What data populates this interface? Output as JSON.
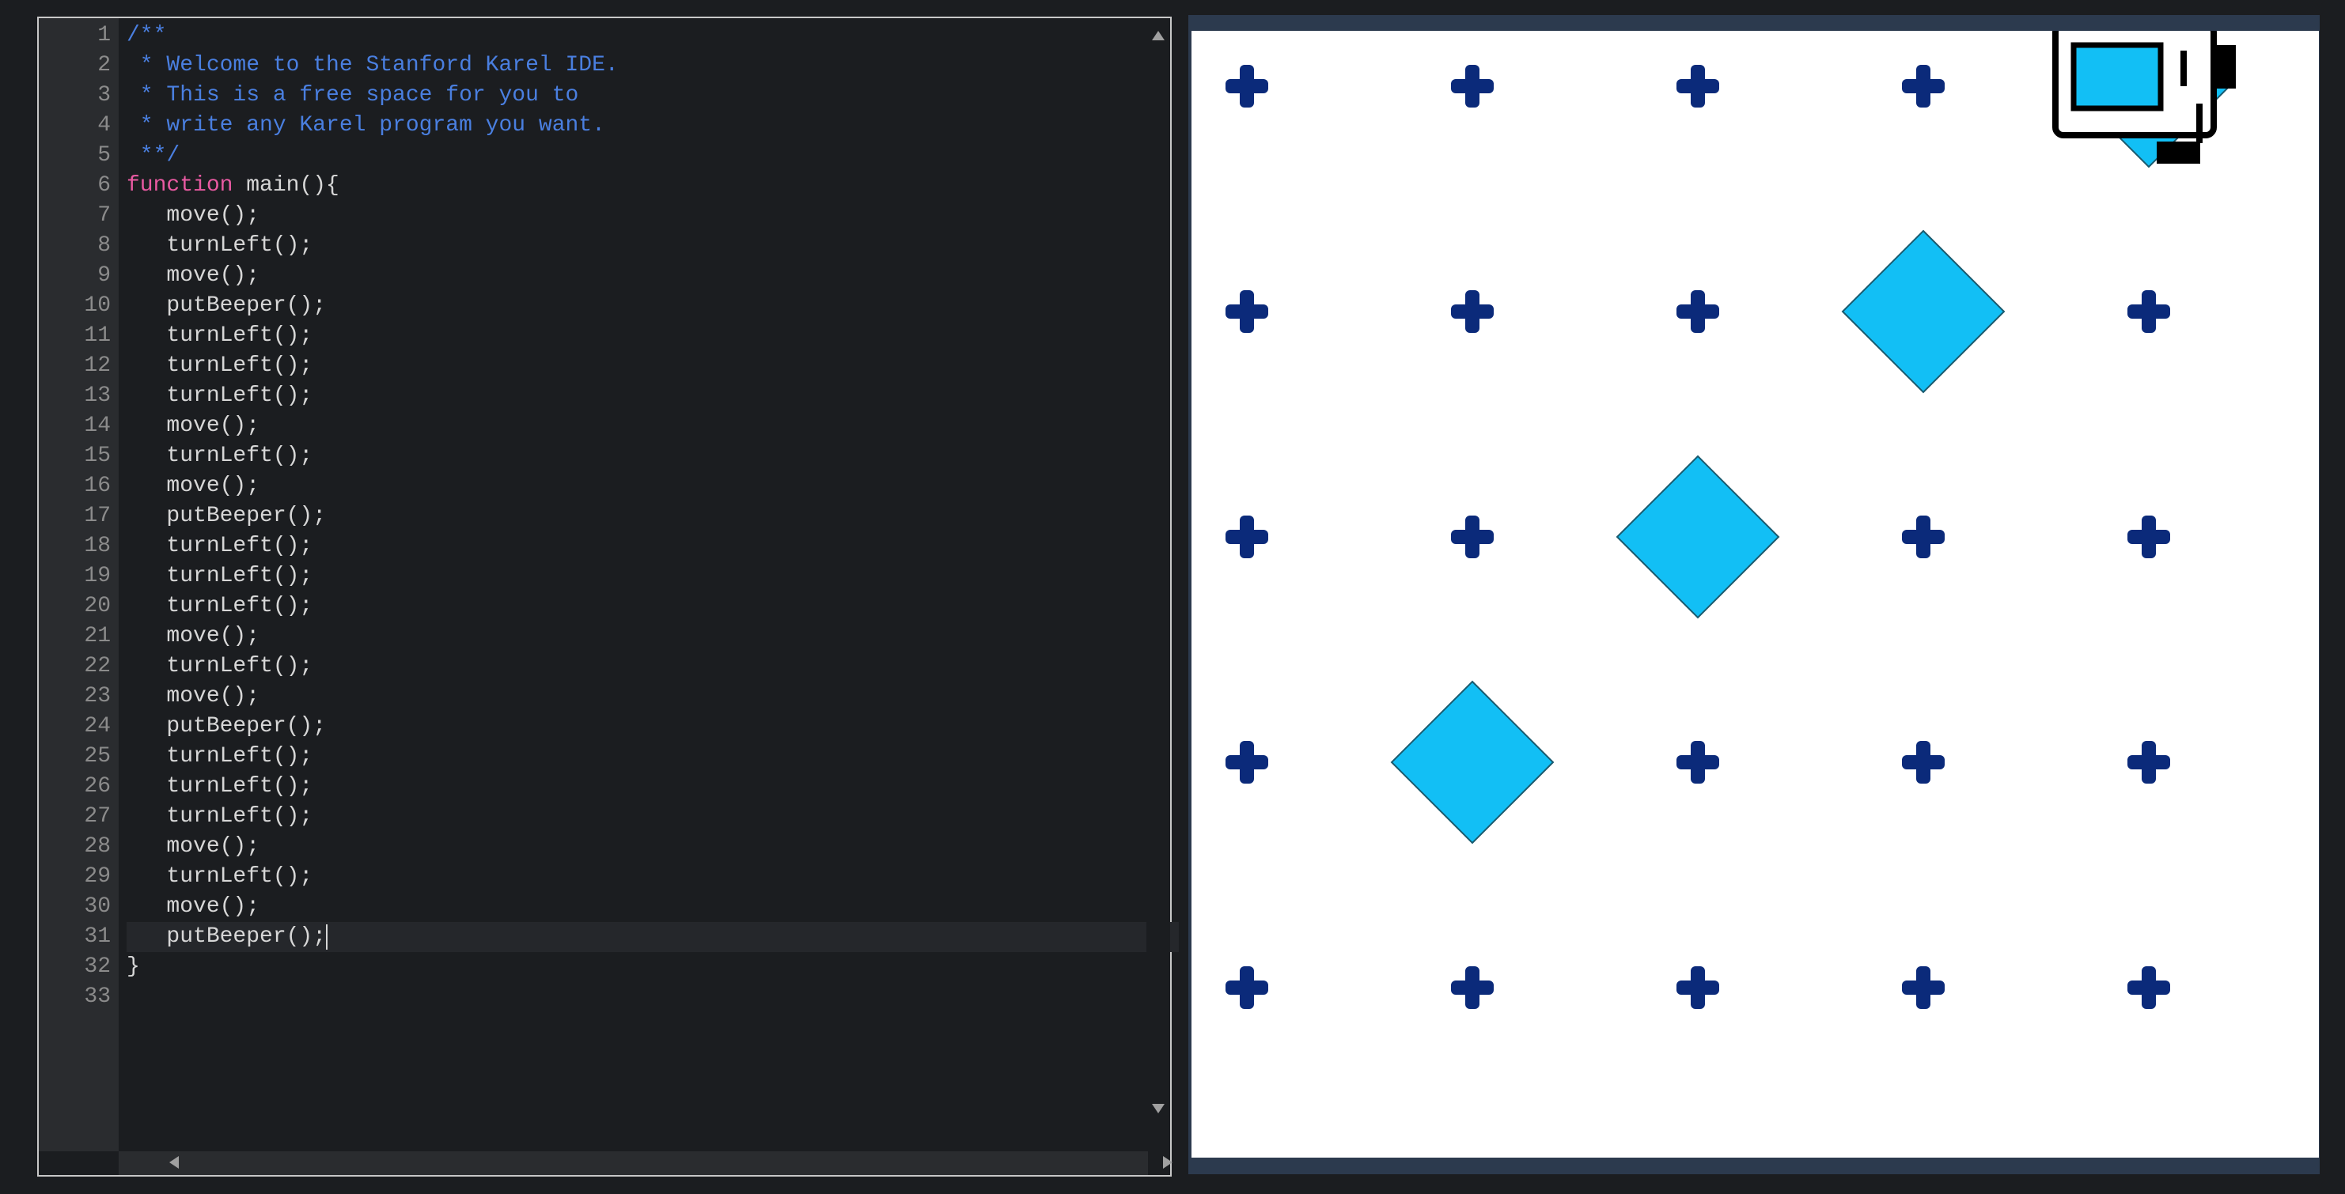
{
  "editor": {
    "lines": [
      {
        "num": "1",
        "text": "/**",
        "style": "comment"
      },
      {
        "num": "2",
        "text": " * Welcome to the Stanford Karel IDE.",
        "style": "comment"
      },
      {
        "num": "3",
        "text": " * This is a free space for you to",
        "style": "comment"
      },
      {
        "num": "4",
        "text": " * write any Karel program you want.",
        "style": "comment"
      },
      {
        "num": "5",
        "text": " **/",
        "style": "comment"
      },
      {
        "num": "6",
        "keyword": "function",
        "text": " main(){",
        "style": "code"
      },
      {
        "num": "7",
        "text": "   move();",
        "style": "code"
      },
      {
        "num": "8",
        "text": "   turnLeft();",
        "style": "code"
      },
      {
        "num": "9",
        "text": "   move();",
        "style": "code"
      },
      {
        "num": "10",
        "text": "   putBeeper();",
        "style": "code"
      },
      {
        "num": "11",
        "text": "   turnLeft();",
        "style": "code"
      },
      {
        "num": "12",
        "text": "   turnLeft();",
        "style": "code"
      },
      {
        "num": "13",
        "text": "   turnLeft();",
        "style": "code"
      },
      {
        "num": "14",
        "text": "   move();",
        "style": "code"
      },
      {
        "num": "15",
        "text": "   turnLeft();",
        "style": "code"
      },
      {
        "num": "16",
        "text": "   move();",
        "style": "code"
      },
      {
        "num": "17",
        "text": "   putBeeper();",
        "style": "code"
      },
      {
        "num": "18",
        "text": "   turnLeft();",
        "style": "code"
      },
      {
        "num": "19",
        "text": "   turnLeft();",
        "style": "code"
      },
      {
        "num": "20",
        "text": "   turnLeft();",
        "style": "code"
      },
      {
        "num": "21",
        "text": "   move();",
        "style": "code"
      },
      {
        "num": "22",
        "text": "   turnLeft();",
        "style": "code"
      },
      {
        "num": "23",
        "text": "   move();",
        "style": "code"
      },
      {
        "num": "24",
        "text": "   putBeeper();",
        "style": "code"
      },
      {
        "num": "25",
        "text": "   turnLeft();",
        "style": "code"
      },
      {
        "num": "26",
        "text": "   turnLeft();",
        "style": "code"
      },
      {
        "num": "27",
        "text": "   turnLeft();",
        "style": "code"
      },
      {
        "num": "28",
        "text": "   move();",
        "style": "code"
      },
      {
        "num": "29",
        "text": "   turnLeft();",
        "style": "code"
      },
      {
        "num": "30",
        "text": "   move();",
        "style": "code"
      },
      {
        "num": "31",
        "text": "   putBeeper();",
        "style": "code"
      },
      {
        "num": "32",
        "text": "}",
        "style": "code"
      },
      {
        "num": "33",
        "text": "",
        "style": "code"
      }
    ],
    "active_line": 31
  },
  "world": {
    "columns": 5,
    "rows": 5,
    "beepers": [
      {
        "col": 2,
        "row": 2
      },
      {
        "col": 3,
        "row": 3
      },
      {
        "col": 4,
        "row": 4
      },
      {
        "col": 5,
        "row": 5
      }
    ],
    "karel": {
      "col": 5,
      "row": 5,
      "direction": "north"
    },
    "colors": {
      "corner_marker": "#0b2a7a",
      "beeper": "#12bff5",
      "beeper_outline": "#1a5a6e",
      "frame": "#2c3a4e"
    }
  }
}
